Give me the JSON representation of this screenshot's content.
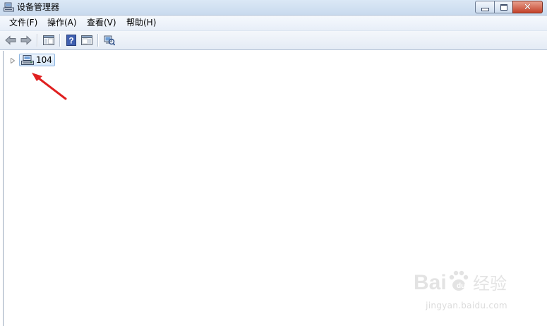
{
  "window": {
    "title": "设备管理器",
    "close_glyph": "✕"
  },
  "menubar": {
    "items": [
      {
        "label": "文件(F)"
      },
      {
        "label": "操作(A)"
      },
      {
        "label": "查看(V)"
      },
      {
        "label": "帮助(H)"
      }
    ]
  },
  "toolbar": {
    "buttons": [
      {
        "icon": "back-arrow-icon"
      },
      {
        "icon": "forward-arrow-icon"
      },
      {
        "icon": "show-hide-console-tree-icon"
      },
      {
        "icon": "help-icon"
      },
      {
        "icon": "show-hide-action-pane-icon"
      },
      {
        "icon": "scan-hardware-changes-icon"
      }
    ]
  },
  "tree": {
    "root": {
      "label": "104",
      "icon": "computer-icon",
      "expanded": false,
      "selected": true
    }
  },
  "annotation": {
    "type": "red-arrow",
    "color": "#e02020"
  },
  "watermark": {
    "logo_text": "Baidu 经验",
    "url": "jingyan.baidu.com"
  }
}
